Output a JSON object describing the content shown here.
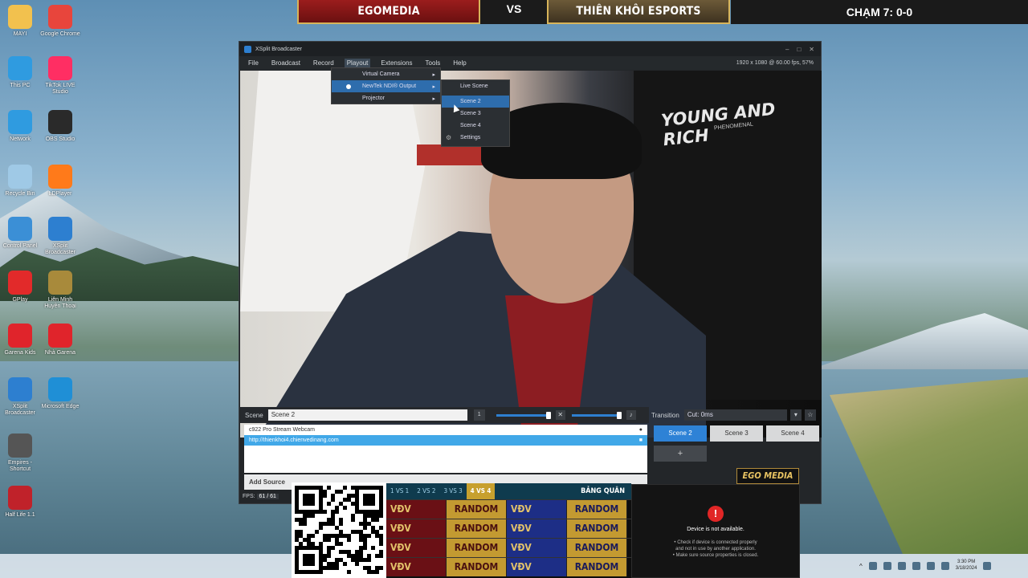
{
  "overlay": {
    "team_left": "EGOMEDIA",
    "vs": "VS",
    "team_right": "THIÊN KHÔI ESPORTS",
    "score": "CHẠM 7: 0-0",
    "ego_badge": "EGO MEDIA"
  },
  "desktop_icons": [
    {
      "label": "MAYI",
      "icon": "folder-icon",
      "color": "#f2c14e"
    },
    {
      "label": "Google Chrome",
      "icon": "chrome-icon",
      "color": "#e8453c"
    },
    {
      "label": "This PC",
      "icon": "monitor-icon",
      "color": "#2f9be0"
    },
    {
      "label": "TikTok LIVE Studio",
      "icon": "tiktok-icon",
      "color": "#ff2e63"
    },
    {
      "label": "Network",
      "icon": "network-icon",
      "color": "#2f9be0"
    },
    {
      "label": "OBS Studio",
      "icon": "obs-icon",
      "color": "#2a2a2a"
    },
    {
      "label": "Recycle Bin",
      "icon": "recycle-bin-icon",
      "color": "#9fc9e6"
    },
    {
      "label": "LDPlayer",
      "icon": "ldplayer-icon",
      "color": "#ff7a1a"
    },
    {
      "label": "Control Panel",
      "icon": "control-panel-icon",
      "color": "#3b8fd6"
    },
    {
      "label": "XSplit Broadcaster",
      "icon": "xsplit-icon",
      "color": "#2d7fd0"
    },
    {
      "label": "GPlay",
      "icon": "gplay-icon",
      "color": "#e22a2a"
    },
    {
      "label": "Liên Minh Huyền Thoại",
      "icon": "league-icon",
      "color": "#a88a3b"
    },
    {
      "label": "Garena Kids",
      "icon": "garena-icon",
      "color": "#e0242b"
    },
    {
      "label": "Nhà Garena",
      "icon": "garena-icon",
      "color": "#e0242b"
    },
    {
      "label": "XSplit Broadcaster",
      "icon": "xsplit-icon",
      "color": "#2d7fd0"
    },
    {
      "label": "Microsoft Edge",
      "icon": "edge-icon",
      "color": "#1f8fd6"
    },
    {
      "label": "Empires - Shortcut",
      "icon": "empires-icon",
      "color": "#555"
    },
    {
      "label": "Half Life 1.1",
      "icon": "halflife-icon",
      "color": "#c0222a"
    }
  ],
  "xsplit": {
    "title": "XSplit Broadcaster",
    "menu": [
      "File",
      "Broadcast",
      "Record",
      "Playout",
      "Extensions",
      "Tools",
      "Help"
    ],
    "resolution": "1920 x 1080 @ 60.00 fps, 57%",
    "playout_menu": [
      "Virtual Camera",
      "NewTek NDI® Output",
      "Projector"
    ],
    "ndi_menu": [
      "Live Scene",
      "Scene 2",
      "Scene 3",
      "Scene 4",
      "Settings"
    ],
    "preview_text": "YOUNG AND RICH",
    "preview_subtext": "PHENOMENAL",
    "scene_label": "Scene",
    "scene_value": "Scene 2",
    "scene_num": "1",
    "sources": [
      {
        "name": "c922 Pro Stream Webcam",
        "selected": false
      },
      {
        "name": "http://thienkhoi4.chienvedinang.com",
        "selected": true
      }
    ],
    "add_source": "Add Source",
    "fps_label": "FPS:",
    "fps_value": "61 / 61",
    "transition_label": "Transition",
    "transition_value": "Cut: 0ms",
    "scenes": [
      "Scene 2",
      "Scene 3",
      "Scene 4"
    ],
    "active_scene": "Scene 2"
  },
  "bracket": {
    "tabs": [
      "1 VS 1",
      "2 VS 2",
      "3 VS 3",
      "4 VS 4"
    ],
    "active_tab": "4 VS 4",
    "title": "BẢNG QUÂN",
    "rows": [
      [
        "VĐV",
        "RANDOM",
        "VĐV",
        "RANDOM"
      ],
      [
        "VĐV",
        "RANDOM",
        "VĐV",
        "RANDOM"
      ],
      [
        "VĐV",
        "RANDOM",
        "VĐV",
        "RANDOM"
      ],
      [
        "VĐV",
        "RANDOM",
        "VĐV",
        "RANDOM"
      ]
    ]
  },
  "device_error": {
    "title": "Device is not available.",
    "tips": [
      "• Check if device is connected properly",
      "and not in use by another application.",
      "• Make sure source properties is closed."
    ]
  },
  "taskbar": {
    "time": "3:30 PM",
    "date": "3/18/2024"
  }
}
